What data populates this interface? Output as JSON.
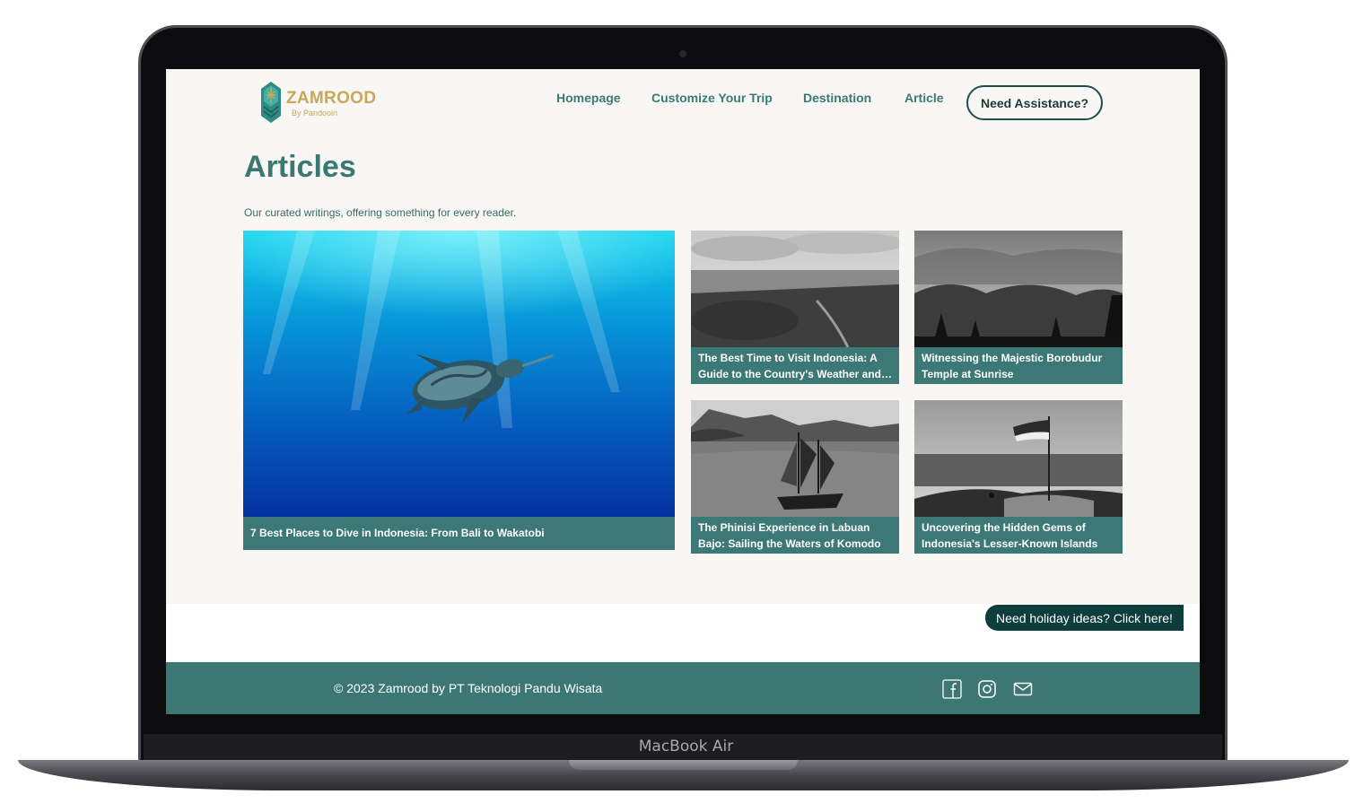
{
  "device": {
    "model_label": "MacBook Air"
  },
  "brand": {
    "name": "ZAMROOD",
    "tagline": "By Pandooin",
    "colors": {
      "primary": "#3c7875",
      "dark": "#0d3e3c",
      "gold": "#c9a85a",
      "background": "#f8f7f4"
    }
  },
  "nav": {
    "items": [
      {
        "label": "Homepage"
      },
      {
        "label": "Customize Your Trip"
      },
      {
        "label": "Destination"
      },
      {
        "label": "Article"
      }
    ],
    "cta_label": "Need Assistance?"
  },
  "main": {
    "title": "Articles",
    "subtitle": "Our curated writings, offering something for every reader.",
    "articles": [
      {
        "title": "7 Best Places to Dive in Indonesia: From Bali to Wakatobi",
        "image": "sea-turtle-underwater"
      },
      {
        "title": "The Best Time to Visit Indonesia: A Guide to the Country's Weather and Seasons",
        "image": "aerial-forest-landscape"
      },
      {
        "title": "Witnessing the Majestic Borobudur Temple at Sunrise",
        "image": "borobudur-misty-sunrise"
      },
      {
        "title": "The Phinisi Experience in Labuan Bajo: Sailing the Waters of Komodo",
        "image": "phinisi-ship-islands"
      },
      {
        "title": "Uncovering the Hidden Gems of Indonesia's Lesser-Known Islands",
        "image": "flag-on-hilltop"
      }
    ]
  },
  "floating_button": {
    "label": "Need holiday ideas? Click here!"
  },
  "footer": {
    "copyright": "© 2023 Zamrood by PT Teknologi Pandu Wisata",
    "social": [
      {
        "icon": "facebook-icon"
      },
      {
        "icon": "instagram-icon"
      },
      {
        "icon": "mail-icon"
      }
    ]
  }
}
